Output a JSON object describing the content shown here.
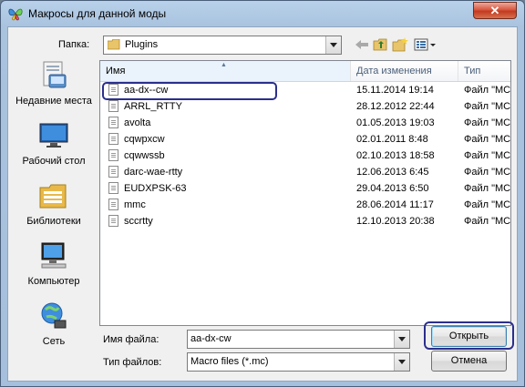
{
  "window": {
    "title": "Макросы для данной моды",
    "close_label": "✕"
  },
  "location": {
    "label": "Папка:",
    "value": "Plugins"
  },
  "places": [
    {
      "label": "Недавние места",
      "icon": "recent-places-icon"
    },
    {
      "label": "Рабочий стол",
      "icon": "desktop-icon"
    },
    {
      "label": "Библиотеки",
      "icon": "libraries-icon"
    },
    {
      "label": "Компьютер",
      "icon": "computer-icon"
    },
    {
      "label": "Сеть",
      "icon": "network-icon"
    }
  ],
  "columns": [
    "Имя",
    "Дата изменения",
    "Тип"
  ],
  "files": [
    {
      "name": "aa-dx--cw",
      "date": "15.11.2014 19:14",
      "type": "Файл \"MC"
    },
    {
      "name": "ARRL_RTTY",
      "date": "28.12.2012 22:44",
      "type": "Файл \"MC"
    },
    {
      "name": "avolta",
      "date": "01.05.2013 19:03",
      "type": "Файл \"MC"
    },
    {
      "name": "cqwpxcw",
      "date": "02.01.2011 8:48",
      "type": "Файл \"MC"
    },
    {
      "name": "cqwwssb",
      "date": "02.10.2013 18:58",
      "type": "Файл \"MC"
    },
    {
      "name": "darc-wae-rtty",
      "date": "12.06.2013 6:45",
      "type": "Файл \"MC"
    },
    {
      "name": "EUDXPSK-63",
      "date": "29.04.2013 6:50",
      "type": "Файл \"MC"
    },
    {
      "name": "mmc",
      "date": "28.06.2014 11:17",
      "type": "Файл \"MC"
    },
    {
      "name": "sccrtty",
      "date": "12.10.2013 20:38",
      "type": "Файл \"MC"
    }
  ],
  "filename": {
    "label": "Имя файла:",
    "value": "aa-dx-cw"
  },
  "filetype": {
    "label": "Тип файлов:",
    "value": "Macro files (*.mc)"
  },
  "buttons": {
    "open": "Открыть",
    "cancel": "Отмена"
  },
  "colors": {
    "title_bar": "#b9d1ea",
    "highlight_ring": "#2b2f8c",
    "close_button": "#d9573f"
  }
}
